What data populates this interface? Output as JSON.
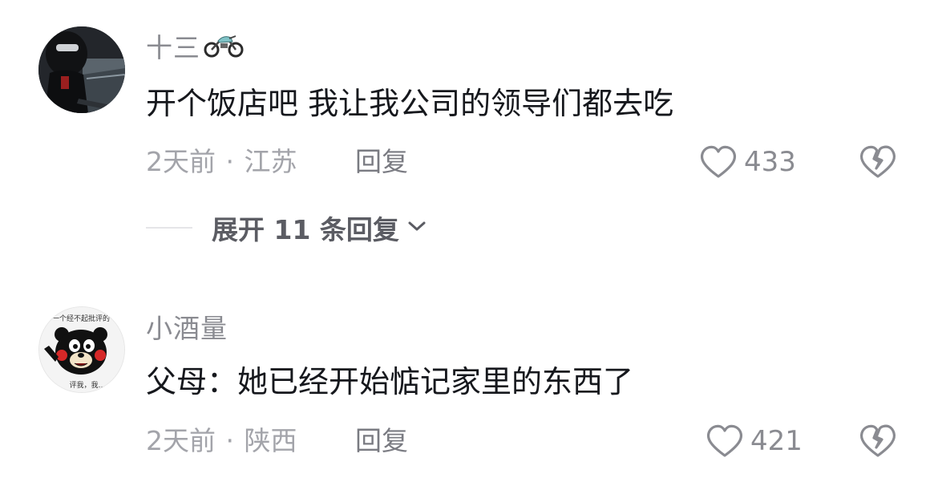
{
  "comments": [
    {
      "username": "十三",
      "content": "开个饭店吧 我让我公司的领导们都去吃",
      "time": "2天前",
      "location": "江苏",
      "reply_label": "回复",
      "likes": "433",
      "expand": {
        "label": "展开 11 条回复",
        "icon": "chevron-down-icon"
      }
    },
    {
      "username": "小酒量",
      "content": "父母：她已经开始惦记家里的东西了",
      "time": "2天前",
      "location": "陕西",
      "reply_label": "回复",
      "likes": "421",
      "avatar_text_top": "一个经不起批评的",
      "avatar_text_bottom": "评我，我…"
    }
  ],
  "meta_separator": "·",
  "icons": {
    "like": "heart-outline-icon",
    "dislike": "broken-heart-icon",
    "username_badge": "motorcycle-icon"
  },
  "colors": {
    "text_primary": "#16181d",
    "text_secondary": "#8a8b91",
    "text_meta": "#a3a4aa"
  }
}
